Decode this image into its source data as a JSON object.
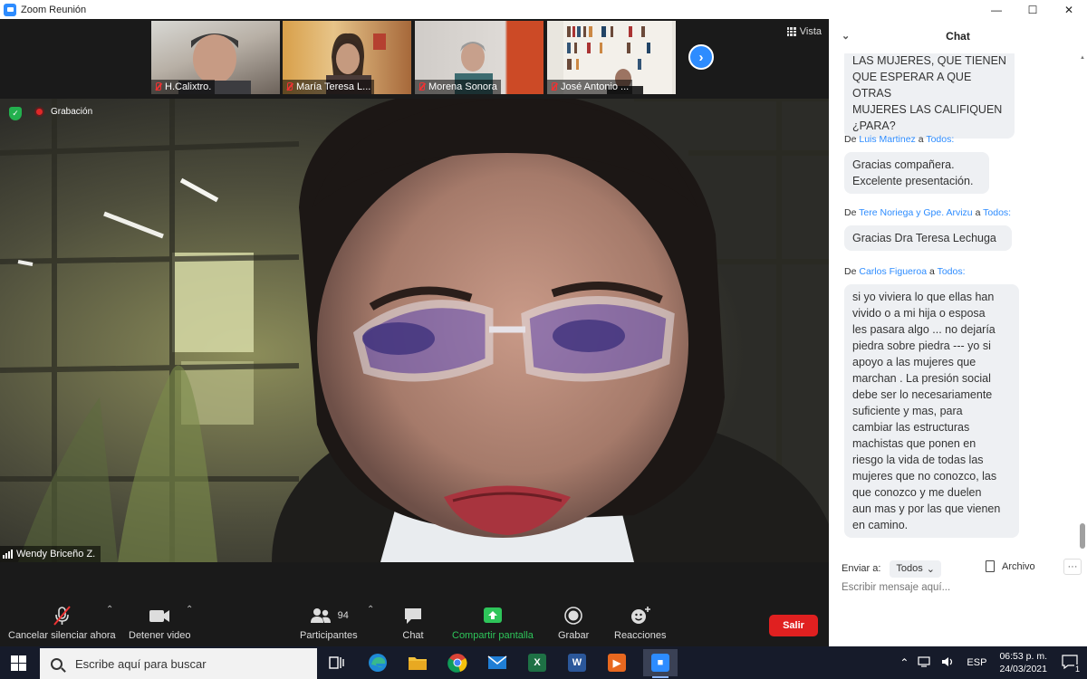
{
  "window": {
    "title": "Zoom Reunión",
    "min": "—",
    "max": "☐",
    "close": "✕"
  },
  "thumbnails": [
    {
      "name": "H.Calixtro."
    },
    {
      "name": "María Teresa L..."
    },
    {
      "name": "Morena Sonora"
    },
    {
      "name": "José Antonio ..."
    }
  ],
  "view_label": "Vista",
  "recording_label": "Grabación",
  "speaker_name": "Wendy Briceño Z.",
  "toolbar": {
    "unmute": "Cancelar silenciar ahora",
    "video": "Detener video",
    "participants": "Participantes",
    "participants_count": "94",
    "chat": "Chat",
    "share": "Compartir pantalla",
    "record": "Grabar",
    "reactions": "Reacciones",
    "leave": "Salir"
  },
  "chat": {
    "header": "Chat",
    "messages": [
      {
        "from": "",
        "to": "",
        "text": "LAS MUJERES, QUE TIENEN\nQUE ESPERAR A QUE OTRAS\nMUJERES LAS CALIFIQUEN\n¿PARA?"
      },
      {
        "from": "Luis Martinez",
        "to": "Todos:",
        "text": "Gracias compañera.\nExcelente presentación."
      },
      {
        "from": "Tere Noriega y Gpe. Arvizu",
        "to": "Todos:",
        "text": "Gracias Dra Teresa Lechuga"
      },
      {
        "from": "Carlos Figueroa",
        "to": "Todos:",
        "text": "si yo viviera lo que ellas han\nvivido o a mi hija o esposa\nles pasara algo ...  no dejaría\npiedra sobre piedra --- yo si\napoyo a las mujeres que\nmarchan . La presión social\ndebe ser lo necesariamente\nsuficiente y mas, para\ncambiar las estructuras\nmachistas que ponen en\nriesgo la vida de todas las\nmujeres que no conozco, las\nque conozco y me duelen\naun mas y por las que vienen\nen camino."
      }
    ],
    "sender_prefix": "De",
    "sender_joiner": "a",
    "send_to_label": "Enviar a:",
    "send_to_value": "Todos",
    "file_label": "Archivo",
    "input_placeholder": "Escribir mensaje aquí..."
  },
  "taskbar": {
    "search_placeholder": "Escribe aquí para buscar",
    "language": "ESP",
    "time": "06:53 p. m.",
    "date": "24/03/2021",
    "notification_count": "1"
  }
}
